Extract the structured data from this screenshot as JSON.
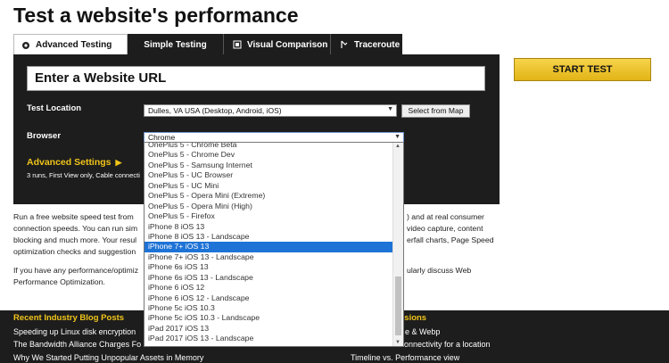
{
  "page": {
    "title": "Test a website's performance"
  },
  "tabs": [
    {
      "label": "Advanced Testing",
      "icon": "gear-icon"
    },
    {
      "label": "Simple Testing"
    },
    {
      "label": "Visual Comparison",
      "icon": "film-icon"
    },
    {
      "label": "Traceroute",
      "icon": "traceroute-icon"
    }
  ],
  "form": {
    "url_placeholder": "Enter a Website URL",
    "test_location_label": "Test Location",
    "test_location_value": "Dulles, VA USA (Desktop, Android, iOS)",
    "select_from_map": "Select from Map",
    "browser_label": "Browser",
    "browser_value": "Chrome",
    "advanced_settings": "Advanced Settings",
    "advanced_summary": "3 runs, First View only, Cable connecti"
  },
  "start_button": "START TEST",
  "intro": {
    "line1": "Run a free website speed test from",
    "line1_right": ") and at real consumer",
    "line2": "connection speeds. You can run sim",
    "line2_right": "video capture, content",
    "line3": "blocking and much more. Your resul",
    "line3_right": "erfall charts, Page Speed",
    "line4": "optimization checks and suggestion",
    "line5": "If you have any performance/optimiz",
    "line5_right": "ularly discuss Web",
    "line6": "Performance Optimization."
  },
  "footer": {
    "blog_heading": "Recent Industry Blog Posts",
    "sessions_heading": "ssions",
    "left_links": [
      "Speeding up Linux disk encryption",
      "The Bandwidth Alliance Charges Fo",
      "Why We Started Putting Unpopular Assets in Memory"
    ],
    "right_links": [
      "e & Webp",
      "onnectivity for a location",
      "Timeline vs. Performance view"
    ]
  },
  "browser_options": {
    "items": [
      "OnePlus 5 - Chrome Beta",
      "OnePlus 5 - Chrome Dev",
      "OnePlus 5 - Samsung Internet",
      "OnePlus 5 - UC Browser",
      "OnePlus 5 - UC Mini",
      "OnePlus 5 - Opera Mini (Extreme)",
      "OnePlus 5 - Opera Mini (High)",
      "OnePlus 5 - Firefox",
      "iPhone 8 iOS 13",
      "iPhone 8 iOS 13 - Landscape",
      "iPhone 7+ iOS 13",
      "iPhone 7+ iOS 13 - Landscape",
      "iPhone 6s iOS 13",
      "iPhone 6s iOS 13 - Landscape",
      "iPhone 6 iOS 12",
      "iPhone 6 iOS 12 - Landscape",
      "iPhone 5c iOS 10.3",
      "iPhone 5c iOS 10.3 - Landscape",
      "iPad 2017 iOS 13",
      "iPad 2017 iOS 13 - Landscape"
    ],
    "selected": "iPhone 7+ iOS 13"
  },
  "colors": {
    "panel": "#1d1d1d",
    "accent": "#f0c419",
    "selection": "#1e73d6"
  }
}
